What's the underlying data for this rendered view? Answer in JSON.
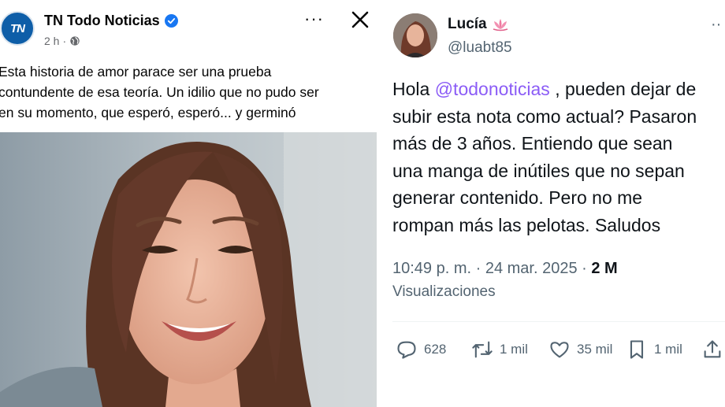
{
  "facebook_post": {
    "logo_text": "TN",
    "page_name": "TN Todo Noticias",
    "time": "2 h",
    "meta_separator": "·",
    "more_glyph": "···",
    "text_lines": [
      "Esta historia de amor parace ser una prueba",
      "contundente de esa teoría. Un idilio que no pudo ser",
      "en su momento, que esperó, esperó... y germinó"
    ],
    "icons": {
      "verified": "verified-badge-icon",
      "privacy": "globe-icon",
      "more": "more-icon",
      "close": "close-icon"
    },
    "colors": {
      "verified": "#1877f2",
      "logo_bg": "#0e5ea8"
    }
  },
  "tweet": {
    "author_name": "Lucía",
    "author_emoji": "lotus-icon",
    "handle": "@luabt85",
    "more_glyph": "··",
    "text": {
      "line1_pre": "Hola ",
      "mention": "@todonoticias",
      "line1_post": " , pueden dejar de",
      "line2": "subir esta nota como actual? Pasaron",
      "line3": "más de 3 años. Entiendo que sean",
      "line4": "una manga de inútiles que no sepan",
      "line5": "generar contenido. Pero no me",
      "line6": "rompan más las pelotas. Saludos"
    },
    "timestamp": "10:49 p. m. · 24 mar. 2025 · ",
    "views_count": "2 M",
    "views_label": "Visualizaciones",
    "actions": {
      "replies": "628",
      "reposts": "1 mil",
      "likes": "35 mil",
      "bookmarks": "1 mil"
    },
    "colors": {
      "mention": "#8b5cf6",
      "secondary_text": "#536471"
    }
  }
}
